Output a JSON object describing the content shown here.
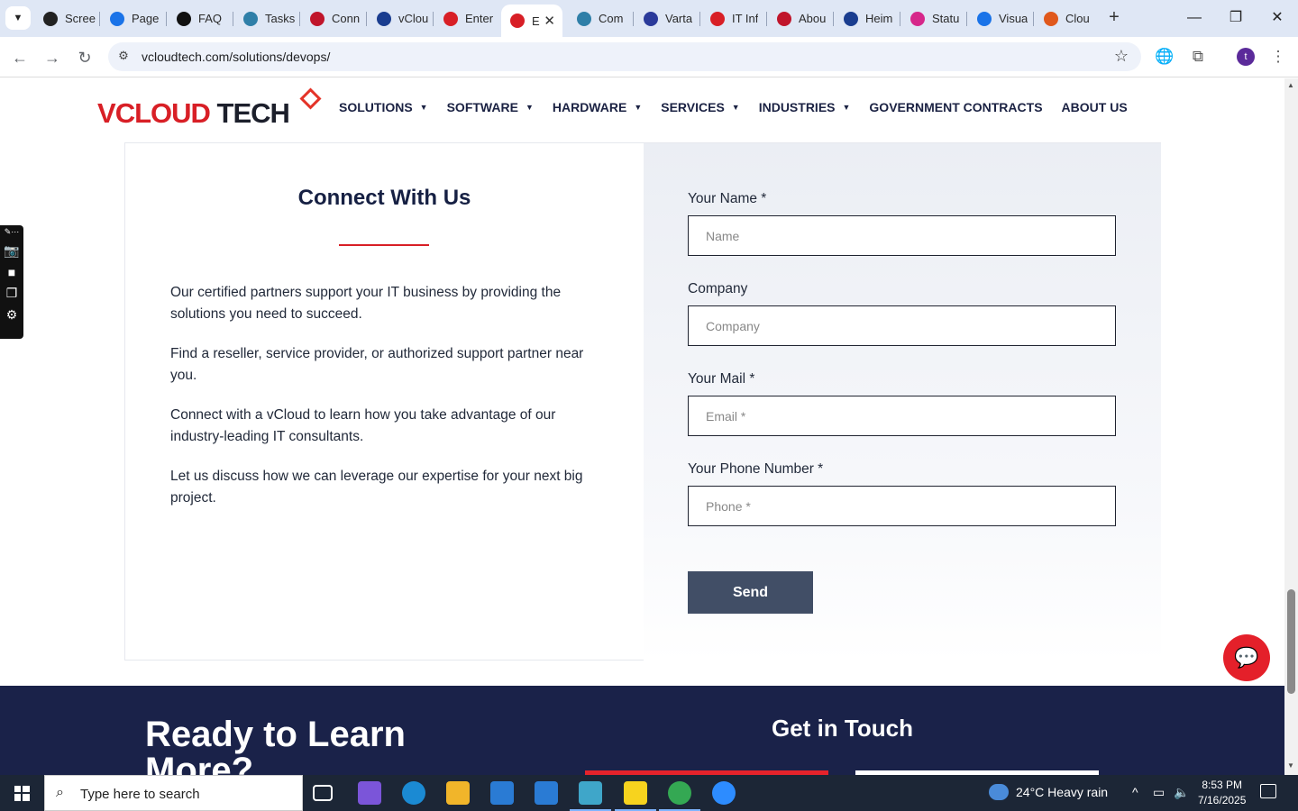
{
  "browser": {
    "tabs": [
      {
        "title": "Scree",
        "color": "#222222"
      },
      {
        "title": "Page",
        "color": "#1a73e8"
      },
      {
        "title": "FAQ",
        "color": "#111111"
      },
      {
        "title": "Tasks",
        "color": "#2f7fa8"
      },
      {
        "title": "Conn",
        "color": "#c0152b"
      },
      {
        "title": "vClou",
        "color": "#1a3d8f"
      },
      {
        "title": "Enter",
        "color": "#d81f26"
      },
      {
        "title": "E",
        "color": "#d81f26"
      },
      {
        "title": "Com",
        "color": "#2f7fa8"
      },
      {
        "title": "Varta",
        "color": "#2b3a9a"
      },
      {
        "title": "IT Inf",
        "color": "#d81f26"
      },
      {
        "title": "Abou",
        "color": "#c0152b"
      },
      {
        "title": "Heim",
        "color": "#1a3d8f"
      },
      {
        "title": "Statu",
        "color": "#d6278a"
      },
      {
        "title": "Visua",
        "color": "#1a73e8"
      },
      {
        "title": "Clou",
        "color": "#e0581c"
      }
    ],
    "active_tab_index": 7,
    "url": "vcloudtech.com/solutions/devops/",
    "profile_initial": "t"
  },
  "site": {
    "logo": {
      "v": "V",
      "cloud": "CLOUD",
      "tech": " TECH"
    },
    "nav": [
      {
        "label": "SOLUTIONS",
        "dropdown": true
      },
      {
        "label": "SOFTWARE",
        "dropdown": true
      },
      {
        "label": "HARDWARE",
        "dropdown": true
      },
      {
        "label": "SERVICES",
        "dropdown": true
      },
      {
        "label": "INDUSTRIES",
        "dropdown": true
      },
      {
        "label": "GOVERNMENT CONTRACTS",
        "dropdown": false
      },
      {
        "label": "ABOUT US",
        "dropdown": false
      }
    ],
    "connect": {
      "title": "Connect With Us",
      "paragraphs": [
        "Our certified partners support your IT business by providing the solutions you need to succeed.",
        "Find a reseller, service provider, or authorized support partner near you.",
        "Connect with a vCloud to learn how you take advantage of our industry-leading IT consultants.",
        "Let us discuss how we can leverage our expertise for your next big project."
      ]
    },
    "form": {
      "name_label": "Your Name *",
      "name_placeholder": "Name",
      "company_label": "Company",
      "company_placeholder": "Company",
      "mail_label": "Your Mail *",
      "mail_placeholder": "Email *",
      "phone_label": "Your Phone Number *",
      "phone_placeholder": "Phone *",
      "send_label": "Send"
    },
    "footer": {
      "ready_title": "Ready to Learn More?",
      "get_in_touch": "Get in Touch"
    }
  },
  "taskbar": {
    "search_placeholder": "Type here to search",
    "weather": "24°C  Heavy rain",
    "time": "8:53 PM",
    "date": "7/16/2025",
    "apps": [
      {
        "name": "task-view",
        "color": "#1c2636"
      },
      {
        "name": "copilot",
        "color": "#7b55d9"
      },
      {
        "name": "edge",
        "color": "#1b8ad3"
      },
      {
        "name": "file-explorer",
        "color": "#f1b52a"
      },
      {
        "name": "store",
        "color": "#2a7bd4"
      },
      {
        "name": "mail",
        "color": "#2a7bd4"
      },
      {
        "name": "vscode-like",
        "color": "#3fa6c9"
      },
      {
        "name": "sticky-notes",
        "color": "#f7d31e"
      },
      {
        "name": "chrome",
        "color": "#34a853"
      },
      {
        "name": "zoom",
        "color": "#2d8cff"
      }
    ]
  }
}
